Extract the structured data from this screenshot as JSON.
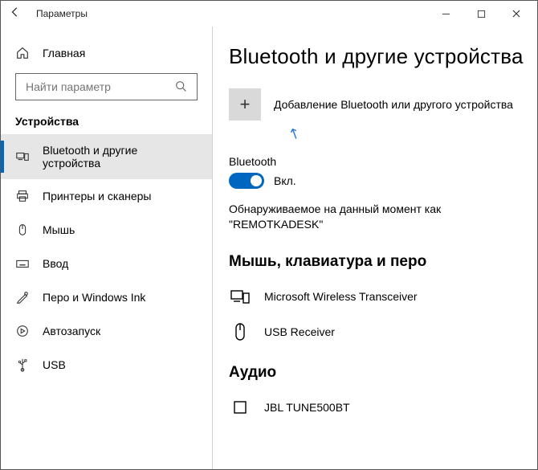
{
  "window": {
    "title": "Параметры"
  },
  "sidebar": {
    "home": "Главная",
    "search_placeholder": "Найти параметр",
    "section": "Устройства",
    "items": [
      "Bluetooth и другие устройства",
      "Принтеры и сканеры",
      "Мышь",
      "Ввод",
      "Перо и Windows Ink",
      "Автозапуск",
      "USB"
    ]
  },
  "content": {
    "heading": "Bluetooth и другие устройства",
    "add_label": "Добавление Bluetooth или другого устройства",
    "bt_label": "Bluetooth",
    "toggle_state": "Вкл.",
    "discoverable": "Обнаруживаемое на данный момент как \"REMOTKADESK\"",
    "group_input": "Мышь, клавиатура и перо",
    "devices_input": [
      "Microsoft Wireless Transceiver",
      "USB Receiver"
    ],
    "group_audio": "Аудио",
    "devices_audio": [
      "JBL TUNE500BT"
    ]
  }
}
